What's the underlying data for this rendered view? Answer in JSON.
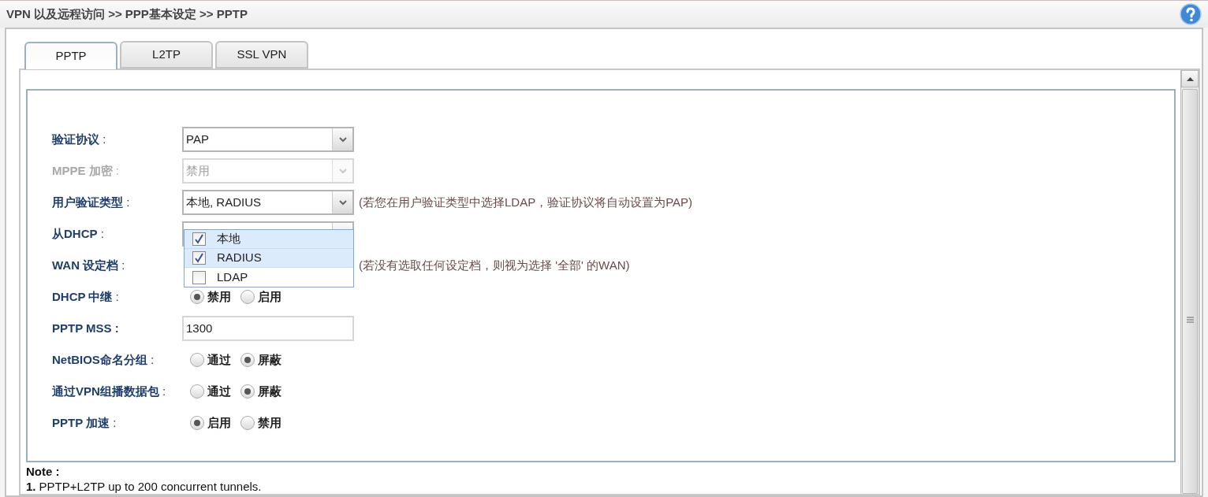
{
  "breadcrumb": "VPN 以及远程访问 >> PPP基本设定 >> PPTP",
  "tabs": [
    {
      "label": "PPTP",
      "selected": true
    },
    {
      "label": "L2TP",
      "selected": false
    },
    {
      "label": "SSL VPN",
      "selected": false
    }
  ],
  "fields": [
    {
      "kind": "select",
      "label": "**验证协议** :",
      "value": "PAP",
      "disabled": false
    },
    {
      "kind": "select",
      "label": "**MPPE 加密** :",
      "value": "禁用",
      "disabled": true
    },
    {
      "kind": "select",
      "label": "**用户验证类型** :",
      "value": "本地, RADIUS",
      "disabled": false,
      "hint": "(若您在用户验证类型中选择LDAP，验证协议将自动设置为PAP)",
      "expanded": true,
      "options": [
        {
          "label": "本地",
          "checked": true
        },
        {
          "label": "RADIUS",
          "checked": true
        },
        {
          "label": "LDAP",
          "checked": false
        }
      ]
    },
    {
      "kind": "select",
      "label": "**从DHCP** :",
      "disabled": false
    },
    {
      "kind": "covered",
      "label": "**WAN 设定档** :",
      "hint": "(若没有选取任何设定档，则视为选择 '全部' 的WAN)"
    },
    {
      "kind": "radio",
      "label": "**DHCP 中继** :",
      "options": [
        {
          "label": "禁用",
          "selected": true
        },
        {
          "label": "启用",
          "selected": false
        }
      ]
    },
    {
      "kind": "text",
      "label": "**PPTP MSS :**",
      "value": "1300"
    },
    {
      "kind": "radio",
      "label": "**NetBIOS命名分组** :",
      "options": [
        {
          "label": "通过",
          "selected": false
        },
        {
          "label": "屏蔽",
          "selected": true
        }
      ]
    },
    {
      "kind": "radio",
      "label": "**通过VPN组播数据包** :",
      "options": [
        {
          "label": "通过",
          "selected": false
        },
        {
          "label": "屏蔽",
          "selected": true
        }
      ]
    },
    {
      "kind": "radio",
      "label": "**PPTP 加速** :",
      "options": [
        {
          "label": "启用",
          "selected": true
        },
        {
          "label": "禁用",
          "selected": false
        }
      ]
    }
  ],
  "note": {
    "title": "Note :",
    "items": [
      {
        "number": "1.",
        "text": "PPTP+L2TP up to 200 concurrent tunnels."
      }
    ]
  }
}
